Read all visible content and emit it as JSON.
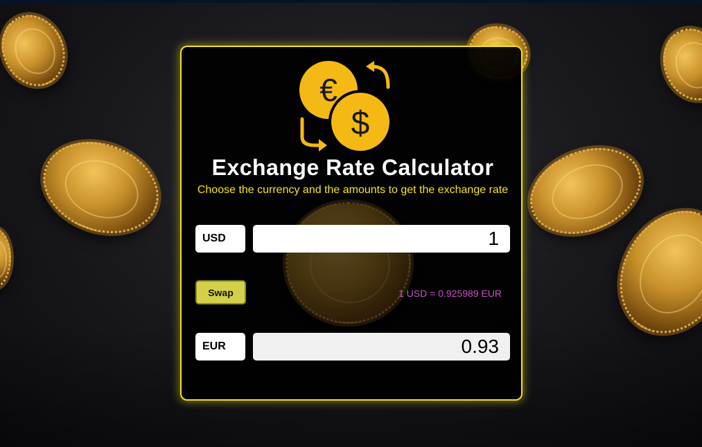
{
  "header": {
    "title": "Exchange Rate Calculator",
    "subtitle": "Choose the currency and the amounts to get the exchange rate"
  },
  "logo": {
    "icon": "currency-exchange-icon",
    "euro_symbol": "€",
    "dollar_symbol": "$",
    "color": "#f5b915"
  },
  "converter": {
    "from_currency": "USD",
    "from_amount": "1",
    "to_currency": "EUR",
    "to_amount": "0.93",
    "swap_label": "Swap",
    "rate_text": "1 USD = 0.925989 EUR"
  },
  "colors": {
    "accent_border": "#f2e020",
    "subtitle": "#f5e420",
    "swap_button": "#d4d04a",
    "rate_text": "#c752c7"
  }
}
